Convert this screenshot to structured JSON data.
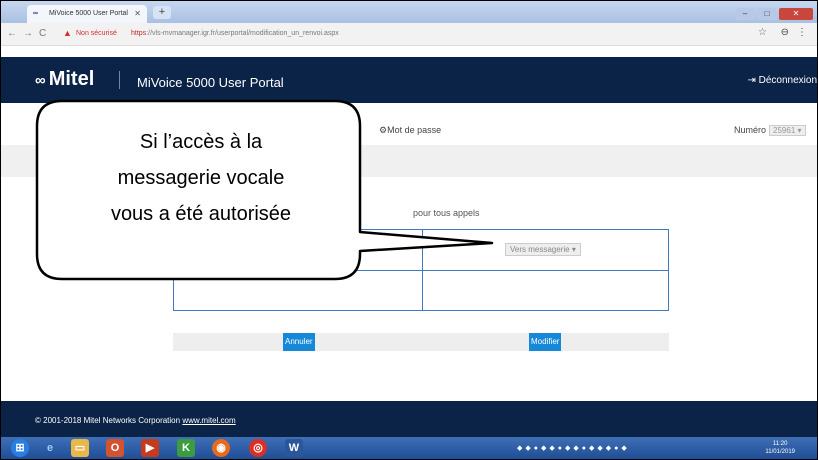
{
  "browser": {
    "tab_title": "MiVoice 5000 User Portal",
    "tab_icon": "mitel-favicon-icon",
    "insecure_label": "Non sécurisé",
    "url_scheme": "https",
    "url_rest": "://vls-mvmanager.igr.fr/userportal/modification_un_renvoi.aspx"
  },
  "header": {
    "logo_text": "Mitel",
    "portal_title": "MiVoice 5000 User Portal",
    "logout_label": "Déconnexion",
    "bg_color": "#0b2346"
  },
  "toolbar": {
    "password_label": "Mot de passe",
    "numero_label": "Numéro",
    "numero_value": "25961"
  },
  "form": {
    "section_label": "pour tous appels",
    "destination_value": "Vers messagerie",
    "cancel_label": "Annuler",
    "modify_label": "Modifier",
    "button_color": "#1588d8"
  },
  "footer": {
    "copyright": "© 2001-2018 Mitel Networks Corporation",
    "link_text": "www.mitel.com"
  },
  "callout": {
    "lines": [
      "Si l’accès à la",
      "messagerie vocale",
      "vous a été autorisée"
    ]
  },
  "taskbar": {
    "time": "11:20",
    "date": "11/01/2019"
  }
}
